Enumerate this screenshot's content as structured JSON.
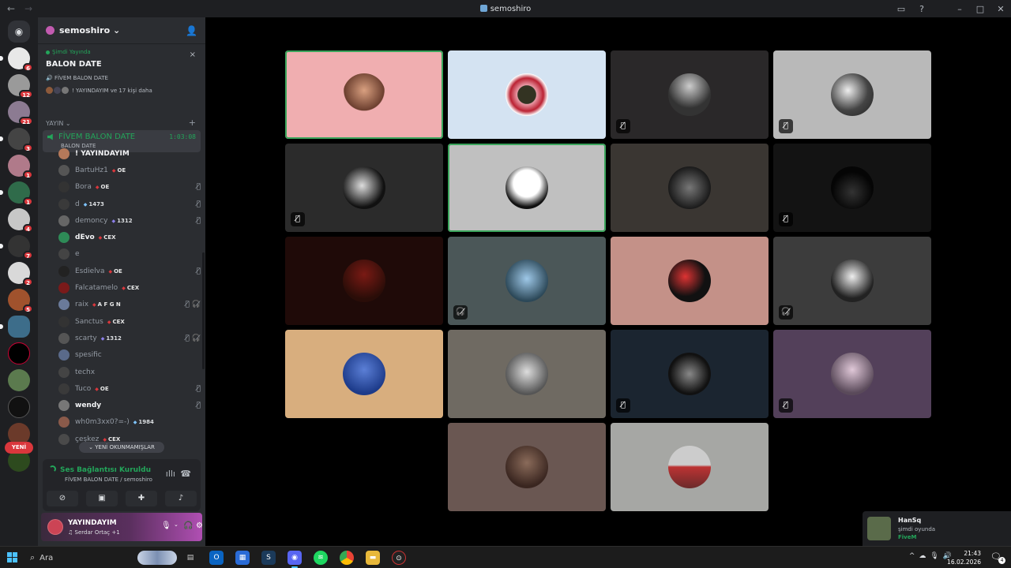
{
  "window": {
    "title": "semoshiro",
    "back": "←",
    "forward": "→"
  },
  "server": {
    "name": "semoshiro ⌄"
  },
  "live": {
    "label": "Şimdi Yayında",
    "title": "BALON DATE",
    "channel": "FİVEM BALON DATE",
    "watchers": "! YAYINDAYIM ve 17 kişi daha",
    "close": "×"
  },
  "category": {
    "name": "YAYIN ⌄",
    "plus": "+"
  },
  "voice_channel": {
    "name": "FİVEM BALON DATE",
    "timer": "1:03:08",
    "desc": "BALON DATE"
  },
  "members": [
    {
      "name": "! YAYINDAYIM",
      "tag": "",
      "bright": true,
      "icons": ""
    },
    {
      "name": "BartuHz1",
      "tag": "OE",
      "bright": false,
      "icons": ""
    },
    {
      "name": "Bora",
      "tag": "OE",
      "bright": false,
      "icons": "🎙̸"
    },
    {
      "name": "d",
      "tag": "1473",
      "bright": false,
      "icons": "🎙̸"
    },
    {
      "name": "demoncy",
      "tag": "1312",
      "bright": false,
      "icons": "🎙̸"
    },
    {
      "name": "dEvo",
      "tag": "CEX",
      "bright": true,
      "icons": ""
    },
    {
      "name": "e",
      "tag": "",
      "bright": false,
      "icons": ""
    },
    {
      "name": "Esdielva",
      "tag": "OE",
      "bright": false,
      "icons": "🎙̸"
    },
    {
      "name": "Falcatamelo",
      "tag": "CEX",
      "bright": false,
      "icons": ""
    },
    {
      "name": "raix",
      "tag": "A F G N",
      "bright": false,
      "icons": "🎙̸ 🎧̸"
    },
    {
      "name": "Sanctus",
      "tag": "CEX",
      "bright": false,
      "icons": ""
    },
    {
      "name": "scarty",
      "tag": "1312",
      "bright": false,
      "icons": "🎙̸ 🎧̸"
    },
    {
      "name": "spesific",
      "tag": "",
      "bright": false,
      "icons": ""
    },
    {
      "name": "techx",
      "tag": "",
      "bright": false,
      "icons": ""
    },
    {
      "name": "Tuco",
      "tag": "OE",
      "bright": false,
      "icons": "🎙̸"
    },
    {
      "name": "wendy",
      "tag": "",
      "bright": true,
      "icons": "🎙̸"
    },
    {
      "name": "wh0m3xx0?=-)",
      "tag": "1984",
      "bright": false,
      "icons": ""
    },
    {
      "name": "çeşkez",
      "tag": "CEX",
      "bright": false,
      "icons": ""
    }
  ],
  "unread_button": "⌄ YENİ OKUNMAMIŞLAR",
  "yeni_badge": "YENİ",
  "voice_status": {
    "title": "Ses Bağlantısı Kuruldu",
    "channel": "FİVEM BALON DATE / semoshiro"
  },
  "user": {
    "name": "YAYINDAYIM",
    "status": "♫ Serdar Ortaç +1"
  },
  "guild_badges": [
    "6",
    "12",
    "21",
    "3",
    "1",
    "1",
    "4",
    "7",
    "2",
    "5"
  ],
  "tile_mute_icon": "🎙̸",
  "tile_deafen_icon": "🎧̸",
  "toast": {
    "name": "HanSq",
    "status": "şimdi oyunda",
    "game": "FiveM"
  },
  "taskbar": {
    "search": "Ara",
    "time": "21:43",
    "date": "16.02.2026",
    "notif_count": "4"
  }
}
